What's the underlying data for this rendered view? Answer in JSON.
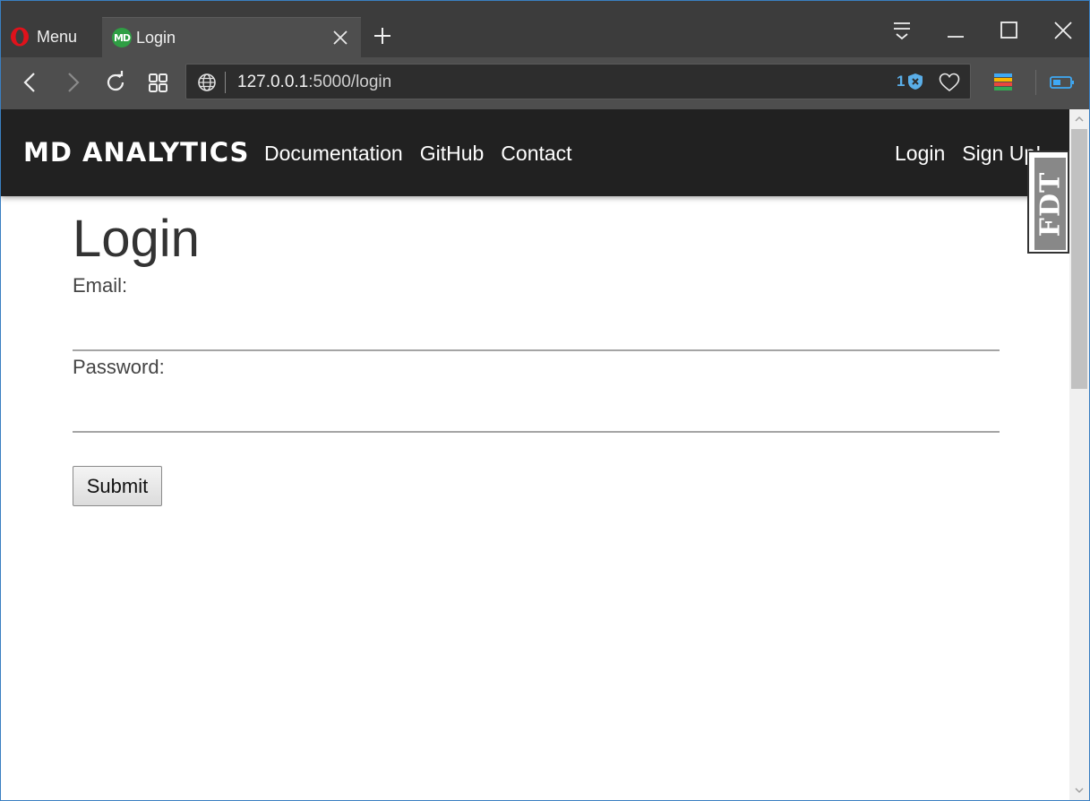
{
  "browser": {
    "menu_label": "Menu",
    "tab_title": "Login",
    "tab_favicon_text": "MD",
    "url_host": "127.0.0.1",
    "url_rest": ":5000/login",
    "tracker_count": "1"
  },
  "navbar": {
    "brand": "MD ANALYTICS",
    "links": [
      "Documentation",
      "GitHub",
      "Contact"
    ],
    "right_links": [
      "Login",
      "Sign Up!"
    ]
  },
  "form": {
    "title": "Login",
    "email_label": "Email:",
    "password_label": "Password:",
    "submit_label": "Submit"
  },
  "overlay": {
    "fdt_text": "FDT"
  },
  "colors": {
    "tab_bar": "#3c3c3c",
    "address_bar": "#4e4e4e",
    "navbar": "#212121",
    "favicon": "#2f9e44",
    "tracker_blue": "#5aaee8",
    "opera_red": "#e0121b"
  },
  "icons": [
    "opera-logo-icon",
    "tab-favicon-icon",
    "close-icon",
    "plus-icon",
    "filter-icon",
    "minimize-icon",
    "maximize-icon",
    "back-icon",
    "forward-icon",
    "reload-icon",
    "speed-dial-icon",
    "globe-icon",
    "shield-icon",
    "heart-icon",
    "extension-icon",
    "battery-icon"
  ]
}
